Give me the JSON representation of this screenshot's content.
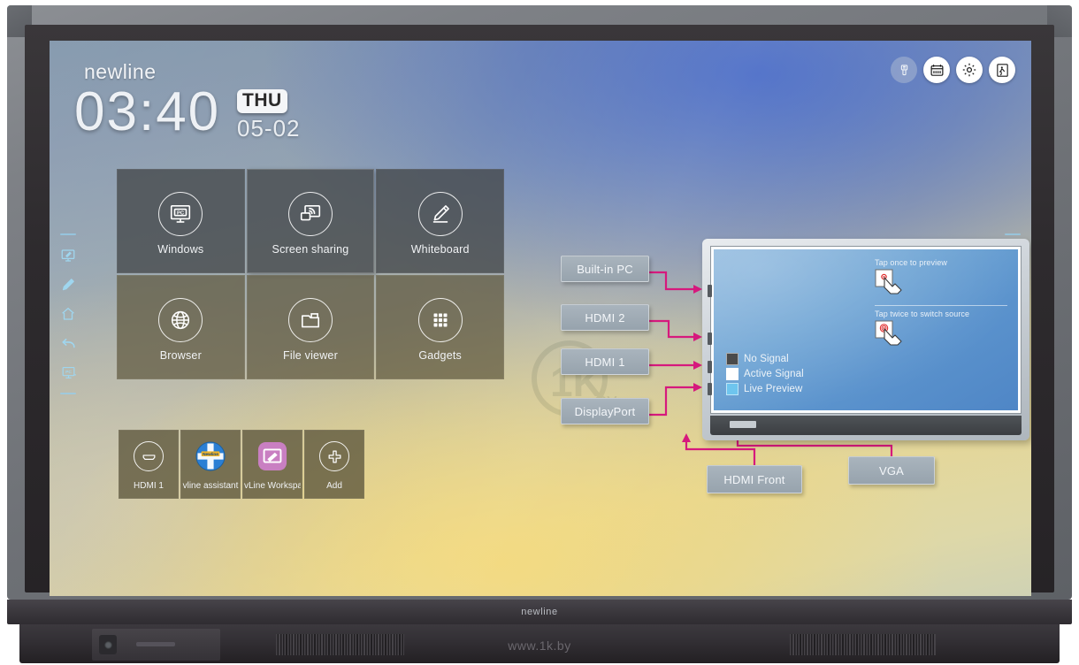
{
  "device": {
    "brand": "newline",
    "bezel_logo": "newline",
    "site_watermark": "www.1k.by"
  },
  "header": {
    "logo": "newline",
    "clock": "03:40",
    "weekday": "THU",
    "date": "05-02"
  },
  "topbar": {
    "icons": [
      {
        "name": "usb-icon",
        "label": "USB",
        "enabled": false
      },
      {
        "name": "calendar-icon",
        "label": "Calendar",
        "enabled": true
      },
      {
        "name": "gear-icon",
        "label": "Settings",
        "enabled": true
      },
      {
        "name": "exit-icon",
        "label": "Exit",
        "enabled": true
      }
    ]
  },
  "tiles": [
    {
      "label": "Windows",
      "icon": "pc-monitor-icon",
      "style": "cool",
      "highlight": false
    },
    {
      "label": "Screen sharing",
      "icon": "screen-share-icon",
      "style": "cool",
      "highlight": true
    },
    {
      "label": "Whiteboard",
      "icon": "pencil-icon",
      "style": "cool",
      "highlight": false
    },
    {
      "label": "Browser",
      "icon": "globe-icon",
      "style": "warm",
      "highlight": false
    },
    {
      "label": "File viewer",
      "icon": "folder-icon",
      "style": "warm",
      "highlight": false
    },
    {
      "label": "Gadgets",
      "icon": "grid-apps-icon",
      "style": "warm",
      "highlight": false
    }
  ],
  "apps": [
    {
      "label": "HDMI 1",
      "icon": "hdmi-icon"
    },
    {
      "label": "vline assistant",
      "icon": "vline-assistant-icon"
    },
    {
      "label": "vLine Workspace",
      "icon": "vline-workspace-icon"
    },
    {
      "label": "Add",
      "icon": "plus-icon"
    }
  ],
  "sidebar": {
    "items": [
      {
        "name": "divider",
        "icon": "divider-icon"
      },
      {
        "name": "annotate",
        "icon": "annotate-screen-icon"
      },
      {
        "name": "pen",
        "icon": "pen-icon"
      },
      {
        "name": "home",
        "icon": "home-icon"
      },
      {
        "name": "back",
        "icon": "back-arrow-icon"
      },
      {
        "name": "source-pc",
        "icon": "pc-source-icon"
      },
      {
        "name": "divider",
        "icon": "divider-icon"
      }
    ]
  },
  "diagram": {
    "left_sources": [
      "Built-in PC",
      "HDMI 2",
      "HDMI 1",
      "DisplayPort"
    ],
    "bottom_sources": [
      "HDMI Front",
      "VGA"
    ],
    "tap_hints": [
      {
        "text": "Tap once to preview",
        "icon": "single-tap-icon"
      },
      {
        "text": "Tap twice to switch source",
        "icon": "double-tap-icon"
      }
    ],
    "legend": [
      {
        "label": "No Signal",
        "color": "#4a4a4a"
      },
      {
        "label": "Active Signal",
        "color": "#ffffff"
      },
      {
        "label": "Live Preview",
        "color": "#6ec5ee"
      }
    ],
    "connector_color": "#d6197d"
  }
}
